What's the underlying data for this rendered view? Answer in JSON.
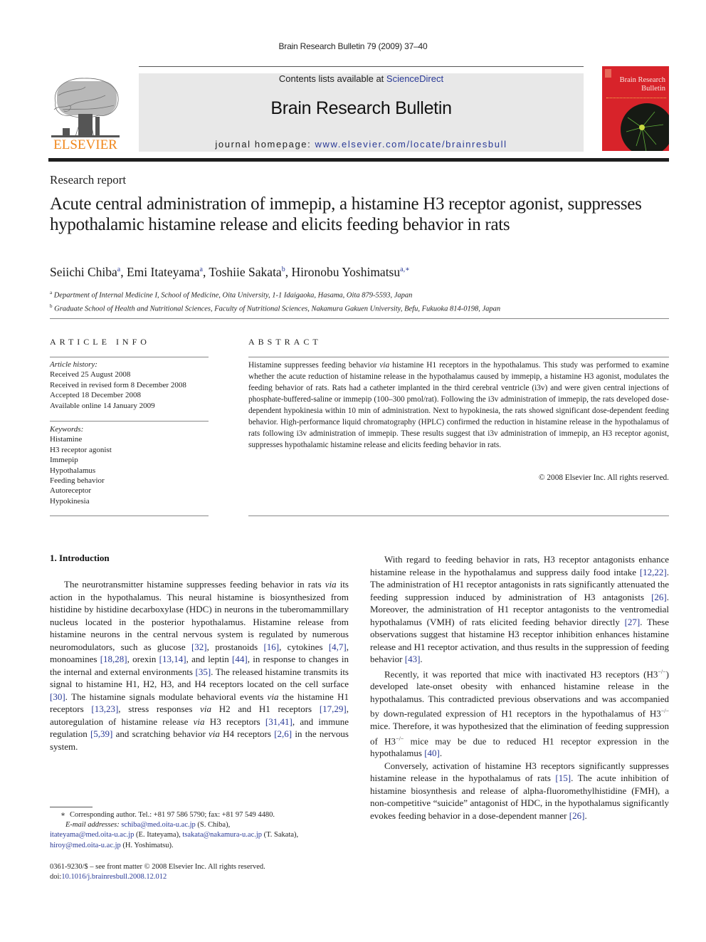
{
  "running_head": "Brain Research Bulletin 79 (2009) 37–40",
  "masthead": {
    "publisher_logo_text": "ELSEVIER",
    "contents_prefix": "Contents lists available at ",
    "contents_link": "ScienceDirect",
    "journal_title": "Brain Research Bulletin",
    "homepage_prefix": "journal homepage: ",
    "homepage_link": "www.elsevier.com/locate/brainresbull",
    "cover_title_line1": "Brain Research",
    "cover_title_line2": "Bulletin",
    "colors": {
      "publisher_orange": "#f0861a",
      "link_blue": "#2a3a96",
      "cover_red": "#d8232a",
      "banner_gray": "#e8e8e8"
    }
  },
  "article": {
    "section_type": "Research report",
    "title": "Acute central administration of immepip, a histamine H3 receptor agonist, suppresses hypothalamic histamine release and elicits feeding behavior in rats",
    "authors": [
      {
        "name": "Seiichi Chiba",
        "aff": "a"
      },
      {
        "name": "Emi Itateyama",
        "aff": "a"
      },
      {
        "name": "Toshiie Sakata",
        "aff": "b"
      },
      {
        "name": "Hironobu Yoshimatsu",
        "aff": "a,∗"
      }
    ],
    "affiliations": [
      {
        "key": "a",
        "text": "Department of Internal Medicine I, School of Medicine, Oita University, 1-1 Idaigaoka, Hasama, Oita 879-5593, Japan"
      },
      {
        "key": "b",
        "text": "Graduate School of Health and Nutritional Sciences, Faculty of Nutritional Sciences, Nakamura Gakuen University, Befu, Fukuoka 814-0198, Japan"
      }
    ]
  },
  "article_info": {
    "heading": "ARTICLE INFO",
    "history_label": "Article history:",
    "history": [
      "Received 25 August 2008",
      "Received in revised form 8 December 2008",
      "Accepted 18 December 2008",
      "Available online 14 January 2009"
    ],
    "keywords_label": "Keywords:",
    "keywords": [
      "Histamine",
      "H3 receptor agonist",
      "Immepip",
      "Hypothalamus",
      "Feeding behavior",
      "Autoreceptor",
      "Hypokinesia"
    ]
  },
  "abstract": {
    "heading": "ABSTRACT",
    "text_1": "Histamine suppresses feeding behavior ",
    "via": "via",
    "text_2": " histamine H1 receptors in the hypothalamus. This study was performed to examine whether the acute reduction of histamine release in the hypothalamus caused by immepip, a histamine H3 agonist, modulates the feeding behavior of rats. Rats had a catheter implanted in the third cerebral ventricle (i3v) and were given central injections of phosphate-buffered-saline or immepip (100–300 pmol/rat). Following the i3v administration of immepip, the rats developed dose-dependent hypokinesia within 10 min of administration. Next to hypokinesia, the rats showed significant dose-dependent feeding behavior. High-performance liquid chromatography (HPLC) confirmed the reduction in histamine release in the hypothalamus of rats following i3v administration of immepip. These results suggest that i3v administration of immepip, an H3 receptor agonist, suppresses hypothalamic histamine release and elicits feeding behavior in rats.",
    "copyright": "© 2008 Elsevier Inc. All rights reserved."
  },
  "intro": {
    "heading": "1.  Introduction",
    "left_paragraph": [
      {
        "t": "The neurotransmitter histamine suppresses feeding behavior in rats "
      },
      {
        "i": "via"
      },
      {
        "t": " its action in the hypothalamus. This neural histamine is biosynthesized from histidine by histidine decarboxylase (HDC) in neurons in the tuberomammillary nucleus located in the posterior hypothalamus. Histamine release from histamine neurons in the central nervous system is regulated by numerous neuromodulators, such as glucose "
      },
      {
        "r": "[32]"
      },
      {
        "t": ", prostanoids "
      },
      {
        "r": "[16]"
      },
      {
        "t": ", cytokines "
      },
      {
        "r": "[4,7]"
      },
      {
        "t": ", monoamines "
      },
      {
        "r": "[18,28]"
      },
      {
        "t": ", orexin "
      },
      {
        "r": "[13,14]"
      },
      {
        "t": ", and leptin "
      },
      {
        "r": "[44]"
      },
      {
        "t": ", in response to changes in the internal and external environments "
      },
      {
        "r": "[35]"
      },
      {
        "t": ". The released histamine transmits its signal to histamine H1, H2, H3, and H4 receptors located on the cell surface "
      },
      {
        "r": "[30]"
      },
      {
        "t": ". The histamine signals modulate behavioral events "
      },
      {
        "i": "via"
      },
      {
        "t": " the histamine H1 receptors "
      },
      {
        "r": "[13,23]"
      },
      {
        "t": ", stress responses "
      },
      {
        "i": "via"
      },
      {
        "t": " H2 and H1 receptors "
      },
      {
        "r": "[17,29]"
      },
      {
        "t": ", autoregulation of histamine release "
      },
      {
        "i": "via"
      },
      {
        "t": " H3 receptors "
      },
      {
        "r": "[31,41]"
      },
      {
        "t": ", and immune regulation "
      },
      {
        "r": "[5,39]"
      },
      {
        "t": " and scratching behavior "
      },
      {
        "i": "via"
      },
      {
        "t": " H4 receptors "
      },
      {
        "r": "[2,6]"
      },
      {
        "t": " in the nervous system."
      }
    ],
    "right_paragraphs": [
      [
        {
          "t": "With regard to feeding behavior in rats, H3 receptor antagonists enhance histamine release in the hypothalamus and suppress daily food intake "
        },
        {
          "r": "[12,22]"
        },
        {
          "t": ". The administration of H1 receptor antagonists in rats significantly attenuated the feeding suppression induced by administration of H3 antagonists "
        },
        {
          "r": "[26]"
        },
        {
          "t": ". Moreover, the administration of H1 receptor antagonists to the ventromedial hypothalamus (VMH) of rats elicited feeding behavior directly "
        },
        {
          "r": "[27]"
        },
        {
          "t": ". These observations suggest that histamine H3 receptor inhibition enhances histamine release and H1 receptor activation, and thus results in the suppression of feeding behavior "
        },
        {
          "r": "[43]"
        },
        {
          "t": "."
        }
      ],
      [
        {
          "t": "Recently, it was reported that mice with inactivated H3 receptors (H3"
        },
        {
          "s": "−/−"
        },
        {
          "t": ") developed late-onset obesity with enhanced histamine release in the hypothalamus. This contradicted previous observations and was accompanied by down-regulated expression of H1 receptors in the hypothalamus of H3"
        },
        {
          "s": "−/−"
        },
        {
          "t": " mice. Therefore, it was hypothesized that the elimination of feeding suppression of H3"
        },
        {
          "s": "−/−"
        },
        {
          "t": " mice may be due to reduced H1 receptor expression in the hypothalamus "
        },
        {
          "r": "[40]"
        },
        {
          "t": "."
        }
      ],
      [
        {
          "t": "Conversely, activation of histamine H3 receptors significantly suppresses histamine release in the hypothalamus of rats "
        },
        {
          "r": "[15]"
        },
        {
          "t": ". The acute inhibition of histamine biosynthesis and release of alpha-fluoromethylhistidine (FMH), a non-competitive “suicide” antagonist of HDC, in the hypothalamus significantly evokes feeding behavior in a dose-dependent manner "
        },
        {
          "r": "[26]"
        },
        {
          "t": "."
        }
      ]
    ]
  },
  "footnote": {
    "star": "∗",
    "corresponding": "Corresponding author. Tel.: +81 97 586 5790; fax: +81 97 549 4480.",
    "email_label": "E-mail addresses:",
    "emails": [
      {
        "addr": "schiba@med.oita-u.ac.jp",
        "who": " (S. Chiba),"
      },
      {
        "addr": "itateyama@med.oita-u.ac.jp",
        "who": " (E. Itateyama), "
      },
      {
        "addr": "tsakata@nakamura-u.ac.jp",
        "who": " (T. Sakata),"
      },
      {
        "addr": "hiroy@med.oita-u.ac.jp",
        "who": " (H. Yoshimatsu)."
      }
    ]
  },
  "front_matter": {
    "issn_line": "0361-9230/$ – see front matter © 2008 Elsevier Inc. All rights reserved.",
    "doi_prefix": "doi:",
    "doi": "10.1016/j.brainresbull.2008.12.012"
  }
}
